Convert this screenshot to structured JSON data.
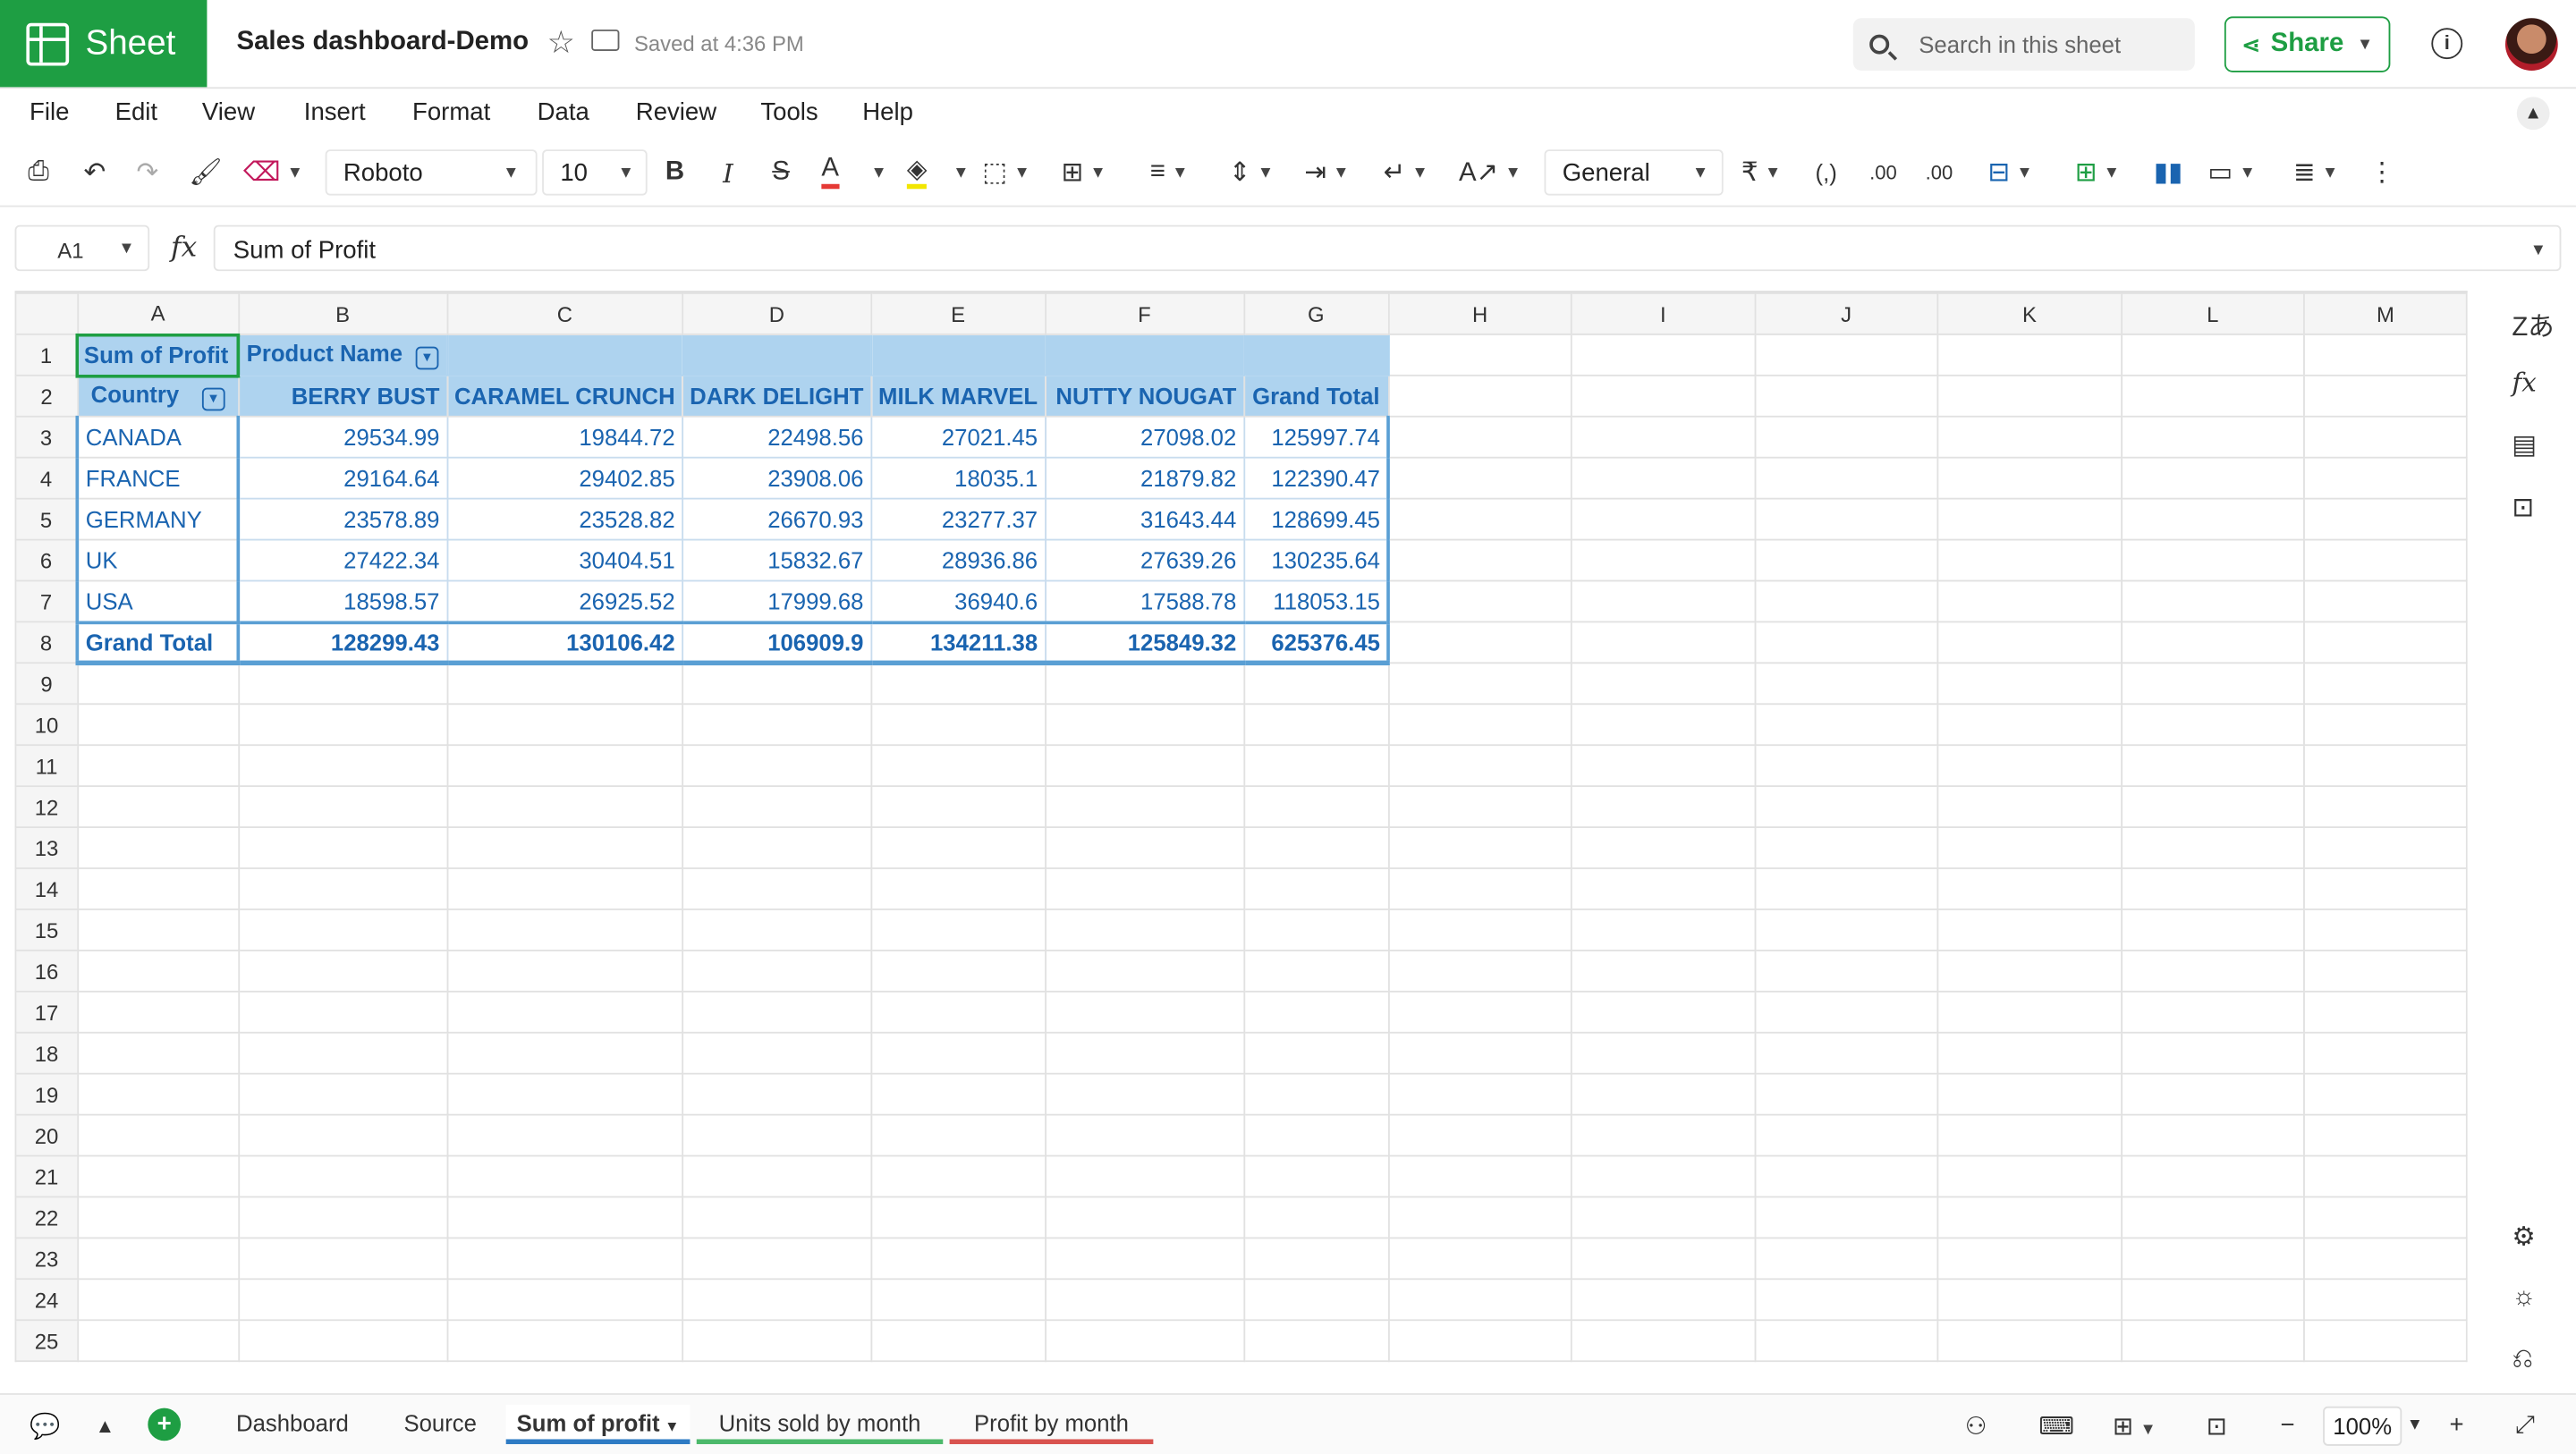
{
  "app": {
    "name": "Sheet",
    "brand_color": "#1e9e43"
  },
  "header": {
    "title": "Sales dashboard-Demo",
    "saved_status": "Saved at 4:36 PM",
    "search_placeholder": "Search in this sheet",
    "share_label": "Share"
  },
  "menu": [
    "File",
    "Edit",
    "View",
    "Insert",
    "Format",
    "Data",
    "Review",
    "Tools",
    "Help"
  ],
  "toolbar": {
    "font": "Roboto",
    "font_size": "10",
    "number_format": "General"
  },
  "formula_bar": {
    "cell_ref": "A1",
    "fx": "fx",
    "content": "Sum of Profit"
  },
  "columns": [
    "A",
    "B",
    "C",
    "D",
    "E",
    "F",
    "G",
    "H",
    "I",
    "J",
    "K",
    "L",
    "M"
  ],
  "pivot": {
    "corner_label": "Sum of Profit",
    "column_field": "Product Name",
    "row_field": "Country",
    "headers": [
      "BERRY BUST",
      "CARAMEL CRUNCH",
      "DARK DELIGHT",
      "MILK MARVEL",
      "NUTTY NOUGAT",
      "Grand Total"
    ],
    "rows": [
      {
        "label": "CANADA",
        "values": [
          "29534.99",
          "19844.72",
          "22498.56",
          "27021.45",
          "27098.02",
          "125997.74"
        ]
      },
      {
        "label": "FRANCE",
        "values": [
          "29164.64",
          "29402.85",
          "23908.06",
          "18035.1",
          "21879.82",
          "122390.47"
        ]
      },
      {
        "label": "GERMANY",
        "values": [
          "23578.89",
          "23528.82",
          "26670.93",
          "23277.37",
          "31643.44",
          "128699.45"
        ]
      },
      {
        "label": "UK",
        "values": [
          "27422.34",
          "30404.51",
          "15832.67",
          "28936.86",
          "27639.26",
          "130235.64"
        ]
      },
      {
        "label": "USA",
        "values": [
          "18598.57",
          "26925.52",
          "17999.68",
          "36940.6",
          "17588.78",
          "118053.15"
        ]
      }
    ],
    "total": {
      "label": "Grand Total",
      "values": [
        "128299.43",
        "130106.42",
        "106909.9",
        "134211.38",
        "125849.32",
        "625376.45"
      ]
    }
  },
  "row_numbers": [
    "1",
    "2",
    "3",
    "4",
    "5",
    "6",
    "7",
    "8",
    "9",
    "10",
    "11",
    "12",
    "13",
    "14",
    "15",
    "16",
    "17",
    "18",
    "19",
    "20",
    "21",
    "22",
    "23",
    "24",
    "25"
  ],
  "sheets": [
    {
      "label": "Dashboard",
      "underline": ""
    },
    {
      "label": "Source",
      "underline": ""
    },
    {
      "label": "Sum of profit",
      "underline": "#2e7bc4",
      "active": true
    },
    {
      "label": "Units sold by month",
      "underline": "#4cb96b"
    },
    {
      "label": "Profit by month",
      "underline": "#d9534f"
    }
  ],
  "zoom": "100%"
}
